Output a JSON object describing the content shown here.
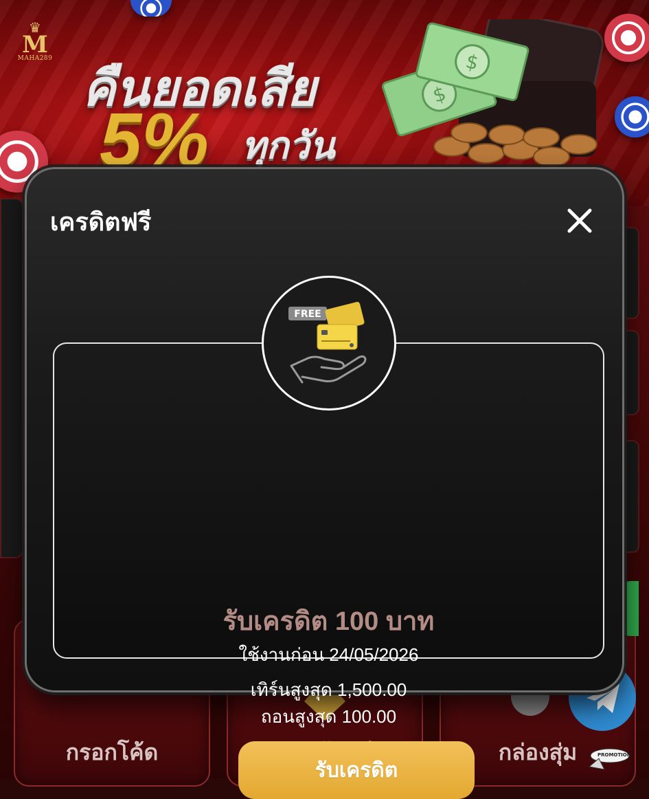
{
  "banner": {
    "logo_text": "MAHA289",
    "headline": "คืนยอดเสีย",
    "percent": "5%",
    "frequency": "ทุกวัน"
  },
  "modal": {
    "title": "เครดิตฟรี",
    "badge_text": "FREE",
    "credit_title": "รับเครดิต 100 บาท",
    "expiry": "ใช้งานก่อน 24/05/2026",
    "max_turnover": "เทิร์นสูงสุด 1,500.00",
    "max_withdraw": "ถอนสูงสุด 100.00",
    "claim_label": "รับเครดิต"
  },
  "tiles": [
    {
      "label": "กรอกโค้ด"
    },
    {
      "label": "รับแต้มฟรี"
    },
    {
      "label": "กล่องสุ่ม"
    }
  ],
  "promo_badge": "PROMOTION",
  "colors": {
    "accent_gold": "#e9b13c",
    "credit_title": "#b48c86",
    "modal_bg": "#1a1a1a",
    "brand_red": "#8a0b0c"
  }
}
